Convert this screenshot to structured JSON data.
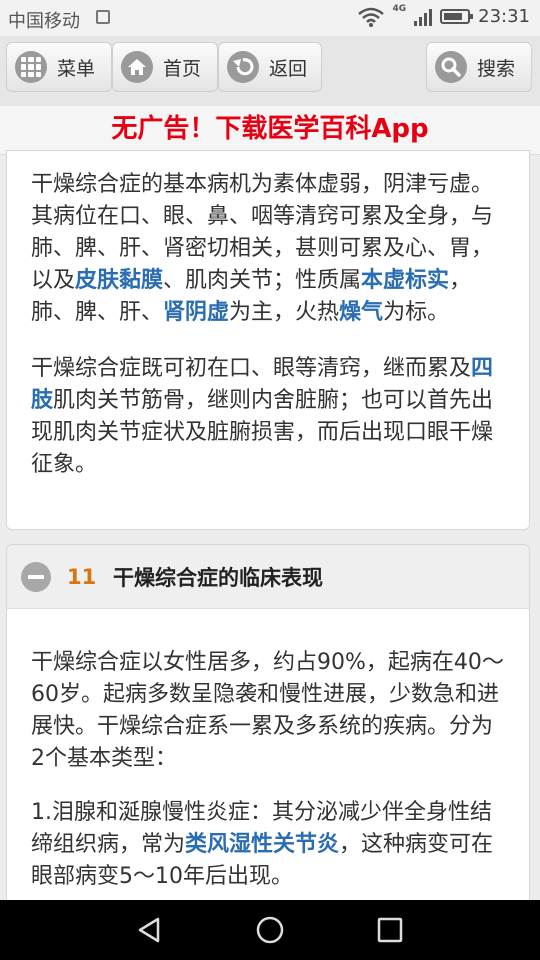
{
  "status_bar": {
    "carrier": "中国移动",
    "network": "4G",
    "time": "23:31"
  },
  "nav": {
    "menu_label": "菜单",
    "home_label": "首页",
    "back_label": "返回",
    "search_label": "搜索"
  },
  "ad_banner": "无广告！下载医学百科App",
  "section10": {
    "para1": [
      {
        "t": "干燥综合症的基本病机为素体虚弱，阴津亏虚。其病位在口、眼、鼻、咽等清窍可累及全身，与肺、脾、肝、肾密切相关，甚则可累及心、胃，以及"
      },
      {
        "t": "皮肤黏膜",
        "link": true
      },
      {
        "t": "、肌肉关节；性质属"
      },
      {
        "t": "本虚标实",
        "link": true
      },
      {
        "t": "，肺、脾、肝、"
      },
      {
        "t": "肾阴虚",
        "link": true
      },
      {
        "t": "为主，火热"
      },
      {
        "t": "燥气",
        "link": true
      },
      {
        "t": "为标。"
      }
    ],
    "para2": [
      {
        "t": "干燥综合症既可初在口、眼等清窍，继而累及"
      },
      {
        "t": "四肢",
        "link": true
      },
      {
        "t": "肌肉关节筋骨，继则内舍脏腑；也可以首先出现肌肉关节症状及脏腑损害，而后出现口眼干燥征象。"
      }
    ]
  },
  "section11": {
    "number": "11",
    "title": "干燥综合症的临床表现",
    "para1": [
      {
        "t": "干燥综合症以女性居多，约占90%，起病在40～60岁。起病多数呈隐袭和慢性进展，少数急和进展快。干燥综合症系一累及多系统的疾病。分为2个基本类型："
      }
    ],
    "para2": [
      {
        "t": "1.泪腺和涎腺慢性炎症：其分泌减少伴全身性结缔组织病，常为"
      },
      {
        "t": "类风湿性关节炎",
        "link": true
      },
      {
        "t": "，这种病变可在眼部病变5～10年后出现。"
      }
    ]
  },
  "colors": {
    "link": "#2a6db3",
    "ad_red": "#e60012",
    "section_number": "#d9740f"
  }
}
